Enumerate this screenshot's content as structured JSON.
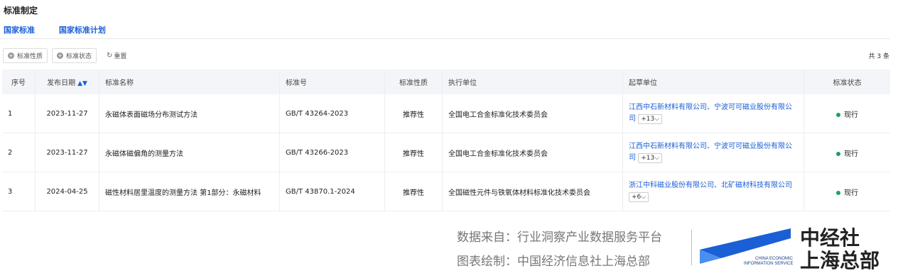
{
  "page_title": "标准制定",
  "tabs": [
    "国家标准",
    "国家标准计划"
  ],
  "filters": {
    "nature": "标准性质",
    "status": "标准状态",
    "reset": "重置"
  },
  "total": "共 3 条",
  "table": {
    "headers": [
      "序号",
      "发布日期",
      "标准名称",
      "标准号",
      "标准性质",
      "执行单位",
      "起草单位",
      "标准状态"
    ],
    "rows": [
      {
        "no": "1",
        "date": "2023-11-27",
        "name": "永磁体表面磁场分布测试方法",
        "code": "GB/T 43264-2023",
        "nature": "推荐性",
        "exec": "全国电工合金标准化技术委员会",
        "drafter": "江西中石新材料有限公司、宁波可可磁业股份有限公司",
        "more": "+13",
        "status": "现行"
      },
      {
        "no": "2",
        "date": "2023-11-27",
        "name": "永磁体磁偏角的测量方法",
        "code": "GB/T 43266-2023",
        "nature": "推荐性",
        "exec": "全国电工合金标准化技术委员会",
        "drafter": "江西中石新材料有限公司、宁波可可磁业股份有限公司",
        "more": "+13",
        "status": "现行"
      },
      {
        "no": "3",
        "date": "2024-04-25",
        "name": "磁性材料居里温度的测量方法 第1部分：永磁材料",
        "code": "GB/T 43870.1-2024",
        "nature": "推荐性",
        "exec": "全国磁性元件与铁氧体材料标准化技术委员会",
        "drafter": "浙江中科磁业股份有限公司、北矿磁材科技有限公司",
        "more": "+6",
        "status": "现行"
      }
    ]
  },
  "footer": {
    "source": "数据来自：行业洞察产业数据服务平台",
    "chart_by": "图表绘制：中国经济信息社上海总部",
    "brand_line1": "中经社",
    "brand_line2": "上海总部",
    "logo_text_1": "CHINA ECONOMIC",
    "logo_text_2": "INFORMATION SERVICE"
  }
}
